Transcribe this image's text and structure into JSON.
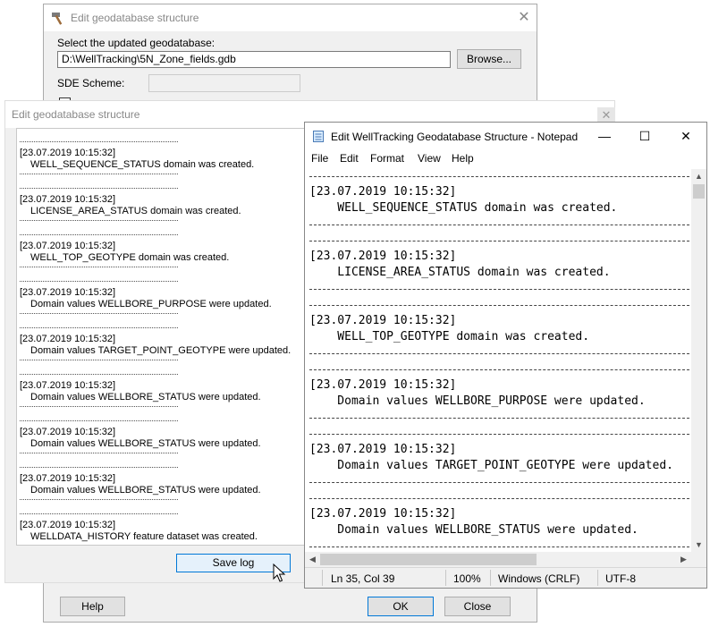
{
  "back_dialog": {
    "title": "Edit geodatabase structure",
    "close_glyph": "✕",
    "select_label": "Select the updated geodatabase:",
    "path_value": "D:\\WellTracking\\5N_Zone_fields.gdb",
    "browse_label": "Browse...",
    "sde_label": "SDE Scheme:",
    "sde_value": "",
    "help_label": "Help",
    "ok_label": "OK",
    "close_label": "Close"
  },
  "log_dialog": {
    "title": "Edit geodatabase structure",
    "close_glyph": "✕",
    "entries": [
      {
        "time": "[23.07.2019 10:15:32]",
        "message": "WELL_SEQUENCE_STATUS domain was created."
      },
      {
        "time": "[23.07.2019 10:15:32]",
        "message": "LICENSE_AREA_STATUS domain was created."
      },
      {
        "time": "[23.07.2019 10:15:32]",
        "message": "WELL_TOP_GEOTYPE domain was created."
      },
      {
        "time": "[23.07.2019 10:15:32]",
        "message": "Domain values WELLBORE_PURPOSE were updated."
      },
      {
        "time": "[23.07.2019 10:15:32]",
        "message": "Domain values TARGET_POINT_GEOTYPE were updated."
      },
      {
        "time": "[23.07.2019 10:15:32]",
        "message": "Domain values WELLBORE_STATUS were updated."
      },
      {
        "time": "[23.07.2019 10:15:32]",
        "message": "Domain values WELLBORE_STATUS were updated."
      },
      {
        "time": "[23.07.2019 10:15:32]",
        "message": "Domain values WELLBORE_STATUS were updated."
      },
      {
        "time": "[23.07.2019 10:15:32]",
        "message": "WELLDATA_HISTORY feature dataset was created."
      }
    ],
    "save_log_label": "Save log"
  },
  "notepad": {
    "title": "Edit WellTracking Geodatabase Structure - Notepad",
    "minimize_glyph": "—",
    "maximize_glyph": "☐",
    "close_glyph": "✕",
    "menu": [
      "File",
      "Edit",
      "Format",
      "View",
      "Help"
    ],
    "entries": [
      {
        "time": "[23.07.2019 10:15:32]",
        "message": "    WELL_SEQUENCE_STATUS domain was created."
      },
      {
        "time": "[23.07.2019 10:15:32]",
        "message": "    LICENSE_AREA_STATUS domain was created."
      },
      {
        "time": "[23.07.2019 10:15:32]",
        "message": "    WELL_TOP_GEOTYPE domain was created."
      },
      {
        "time": "[23.07.2019 10:15:32]",
        "message": "    Domain values WELLBORE_PURPOSE were updated."
      },
      {
        "time": "[23.07.2019 10:15:32]",
        "message": "    Domain values TARGET_POINT_GEOTYPE were updated."
      },
      {
        "time": "[23.07.2019 10:15:32]",
        "message": "    Domain values WELLBORE_STATUS were updated."
      }
    ],
    "status": {
      "position": "Ln 35, Col 39",
      "zoom": "100%",
      "line_ending": "Windows (CRLF)",
      "encoding": "UTF-8"
    },
    "scroll_up_glyph": "▲",
    "scroll_down_glyph": "▼",
    "scroll_left_glyph": "◀",
    "scroll_right_glyph": "▶"
  }
}
